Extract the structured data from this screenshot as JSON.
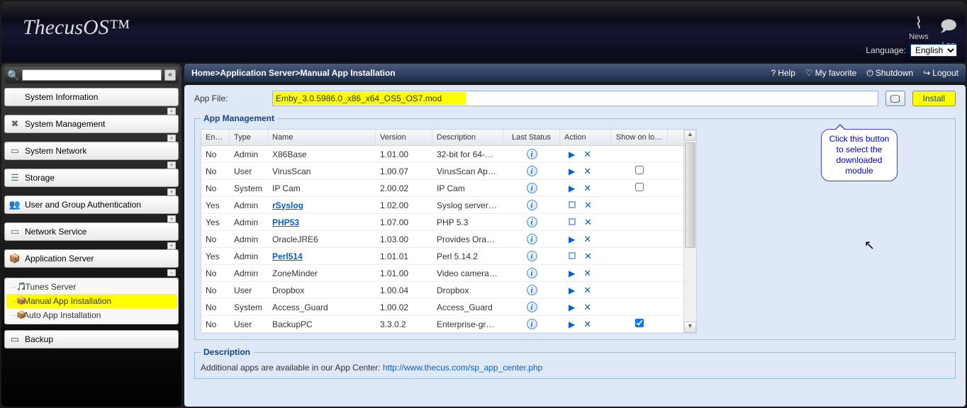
{
  "header": {
    "logo": "ThecusOS™",
    "news": "News",
    "log": "Log",
    "language_label": "Language:",
    "language_value": "English"
  },
  "breadcrumb": {
    "home": "Home",
    "sep": " > ",
    "l1": "Application Server",
    "l2": "Manual App Installation"
  },
  "topbar": {
    "help": "Help",
    "favorite": "My favorite",
    "shutdown": "Shutdown",
    "logout": "Logout"
  },
  "appfile": {
    "label": "App File:",
    "filename": "Emby_3.0.5986.0_x86_x64_OS5_OS7.mod",
    "install": "Install"
  },
  "management": {
    "legend": "App Management",
    "cols": {
      "ena": "Ena…",
      "type": "Type",
      "name": "Name",
      "ver": "Version",
      "desc": "Description",
      "stat": "Last Status",
      "act": "Action",
      "show": "Show on lo…"
    },
    "rows": [
      {
        "ena": "No",
        "type": "Admin",
        "name": "X86Base",
        "link": false,
        "ver": "1.01.00",
        "desc": "32-bit for 64-…",
        "action": "play",
        "show": ""
      },
      {
        "ena": "No",
        "type": "User",
        "name": "VirusScan",
        "link": false,
        "ver": "1.00.07",
        "desc": "VirusScan Ap…",
        "action": "play",
        "show": "chk"
      },
      {
        "ena": "No",
        "type": "System",
        "name": "IP Cam",
        "link": false,
        "ver": "2.00.02",
        "desc": "IP Cam",
        "action": "play",
        "show": "chk"
      },
      {
        "ena": "Yes",
        "type": "Admin",
        "name": "rSyslog",
        "link": true,
        "ver": "1.02.00",
        "desc": "Syslog server …",
        "action": "sq",
        "show": ""
      },
      {
        "ena": "Yes",
        "type": "Admin",
        "name": "PHP53",
        "link": true,
        "ver": "1.07.00",
        "desc": "PHP 5.3",
        "action": "sq",
        "show": ""
      },
      {
        "ena": "No",
        "type": "Admin",
        "name": "OracleJRE6",
        "link": false,
        "ver": "1.03.00",
        "desc": "Provides Oracl…",
        "action": "play",
        "show": ""
      },
      {
        "ena": "Yes",
        "type": "Admin",
        "name": "Perl514",
        "link": true,
        "ver": "1.01.01",
        "desc": "Perl 5.14.2",
        "action": "sq",
        "show": ""
      },
      {
        "ena": "No",
        "type": "Admin",
        "name": "ZoneMinder",
        "link": false,
        "ver": "1.01.00",
        "desc": "Video camera…",
        "action": "play",
        "show": ""
      },
      {
        "ena": "No",
        "type": "User",
        "name": "Dropbox",
        "link": false,
        "ver": "1.00.04",
        "desc": "Dropbox",
        "action": "play",
        "show": ""
      },
      {
        "ena": "No",
        "type": "System",
        "name": "Access_Guard",
        "link": false,
        "ver": "1.00.02",
        "desc": "Access_Guard",
        "action": "play",
        "show": ""
      },
      {
        "ena": "No",
        "type": "User",
        "name": "BackupPC",
        "link": false,
        "ver": "3.3.0.2",
        "desc": "Enterprise-gra…",
        "action": "play",
        "show": "chkd"
      }
    ]
  },
  "description": {
    "legend": "Description",
    "text": "Additional apps are available in our App Center: ",
    "url": "http://www.thecus.com/sp_app_center.php"
  },
  "nav": {
    "items": [
      {
        "label": "System Information",
        "icon": "i-info",
        "glyph": "ℹ"
      },
      {
        "label": "System Management",
        "icon": "i-gear",
        "glyph": "✖"
      },
      {
        "label": "System Network",
        "icon": "i-net",
        "glyph": "▭"
      },
      {
        "label": "Storage",
        "icon": "i-disk",
        "glyph": "☰"
      },
      {
        "label": "User and Group Authentication",
        "icon": "i-user",
        "glyph": "👥"
      },
      {
        "label": "Network Service",
        "icon": "i-ns",
        "glyph": "▭"
      },
      {
        "label": "Application Server",
        "icon": "i-app",
        "glyph": "📦"
      }
    ],
    "sub": [
      {
        "label": "iTunes Server",
        "cls": "",
        "glyph": "🎵",
        "icon": "i-music"
      },
      {
        "label": "Manual App Installation",
        "cls": "active",
        "glyph": "📦",
        "icon": "i-maint"
      },
      {
        "label": "Auto App Installation",
        "cls": "",
        "glyph": "📦",
        "icon": "i-auto"
      }
    ],
    "backup": {
      "label": "Backup",
      "icon": "i-bak",
      "glyph": "▭"
    }
  },
  "callout": "Click this button to select the downloaded module"
}
